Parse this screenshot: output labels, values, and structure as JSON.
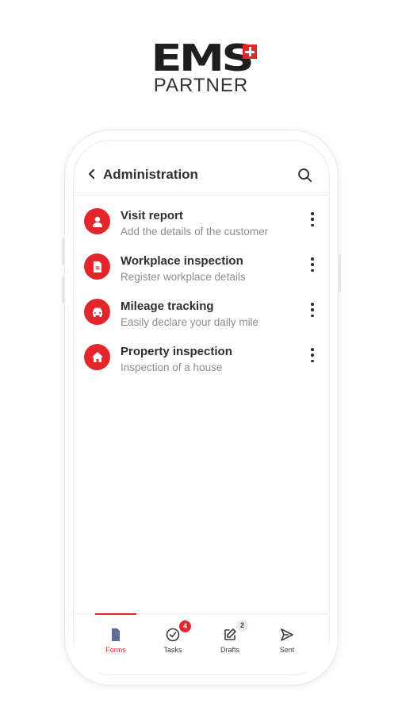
{
  "brand": {
    "logo_text": "EMS",
    "subtitle": "PARTNER",
    "accent_color": "#e3262c"
  },
  "header": {
    "title": "Administration",
    "back_icon": "chevron-left-icon",
    "search_icon": "search-icon"
  },
  "forms": [
    {
      "title": "Visit report",
      "subtitle": "Add the details of the customer",
      "icon": "user-icon"
    },
    {
      "title": "Workplace inspection",
      "subtitle": "Register workplace details",
      "icon": "document-icon"
    },
    {
      "title": "Mileage tracking",
      "subtitle": "Easily declare your daily mile",
      "icon": "car-icon"
    },
    {
      "title": "Property inspection",
      "subtitle": "Inspection of a house",
      "icon": "house-icon"
    }
  ],
  "bottom_nav": {
    "items": [
      {
        "label": "Forms",
        "icon": "forms-icon",
        "active": true
      },
      {
        "label": "Tasks",
        "icon": "check-circle-icon",
        "badge": "4"
      },
      {
        "label": "Drafts",
        "icon": "edit-icon",
        "badge": "2"
      },
      {
        "label": "Sent",
        "icon": "send-icon"
      }
    ]
  }
}
